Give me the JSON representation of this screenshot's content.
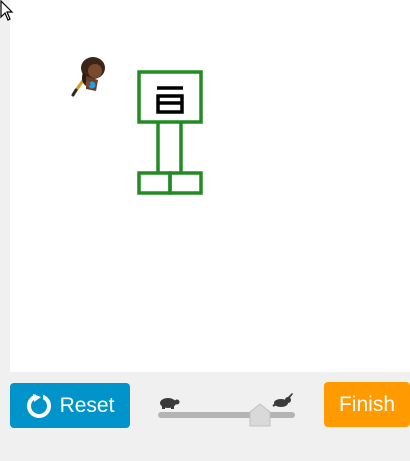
{
  "controls": {
    "reset_label": "Reset",
    "finish_label": "Finish",
    "speed_slider": {
      "value_fraction": 0.72,
      "slow_icon": "turtle-icon",
      "fast_icon": "rabbit-icon"
    }
  },
  "drawing": {
    "line_color": "#228b22",
    "stroke": "green-lines"
  },
  "colors": {
    "reset_button": "#0094ca",
    "finish_button": "#ff9a00",
    "canvas": "#ffffff",
    "background": "#f0f0f0"
  }
}
